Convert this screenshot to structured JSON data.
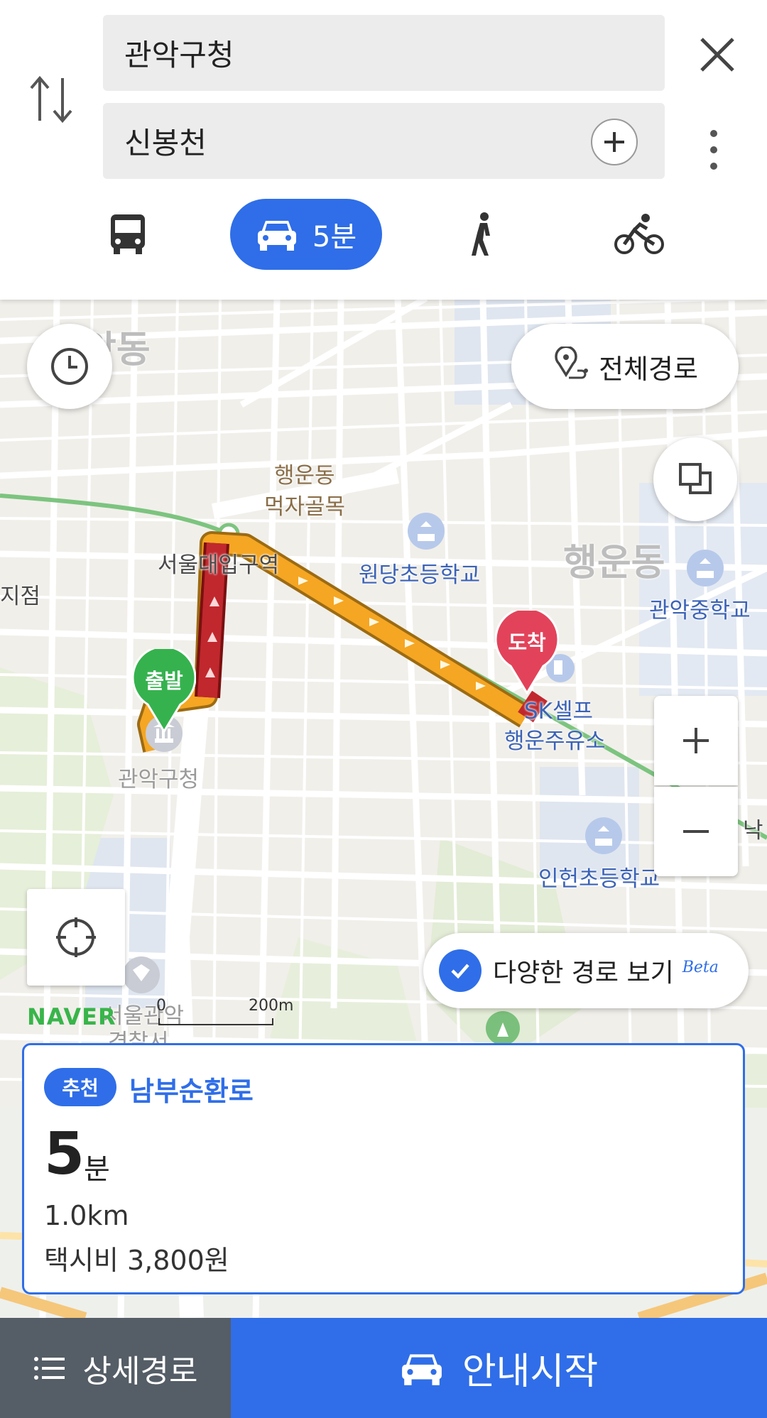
{
  "search": {
    "origin": "관악구청",
    "destination": "신봉천"
  },
  "modes": {
    "car_time": "5분"
  },
  "map": {
    "labels": {
      "haengun_dong_big": "행운동",
      "ang_dong_big": "앙동",
      "haengun_alley_line1": "행운동",
      "haengun_alley_line2": "먹자골목",
      "station": "서울대입구역",
      "wondang_school": "원당초등학교",
      "gwanak_middle": "관악중학교",
      "jijeom": "지점",
      "gwanak_office": "관악구청",
      "sk_line1": "SK셀프",
      "sk_line2": "행운주유소",
      "inheon_school": "인헌초등학교",
      "police_line1": "서울관악",
      "police_line2": "경찰서",
      "nak": "낙"
    },
    "start_pin": "출발",
    "end_pin": "도착",
    "full_route": "전체경로",
    "brand": "NAVER",
    "scale_zero": "0",
    "scale_label": "200m",
    "varied_routes": "다양한 경로 보기",
    "beta": "Beta",
    "route_color": "#f5a623",
    "congested_color": "#c0282d",
    "accent_color": "#2f6ee8"
  },
  "route_card": {
    "badge": "추천",
    "route_name": "남부순환로",
    "time_value": "5",
    "time_unit": "분",
    "distance": "1.0km",
    "taxi_fare": "택시비 3,800원"
  },
  "bottom_bar": {
    "detail_label": "상세경로",
    "start_label": "안내시작"
  }
}
